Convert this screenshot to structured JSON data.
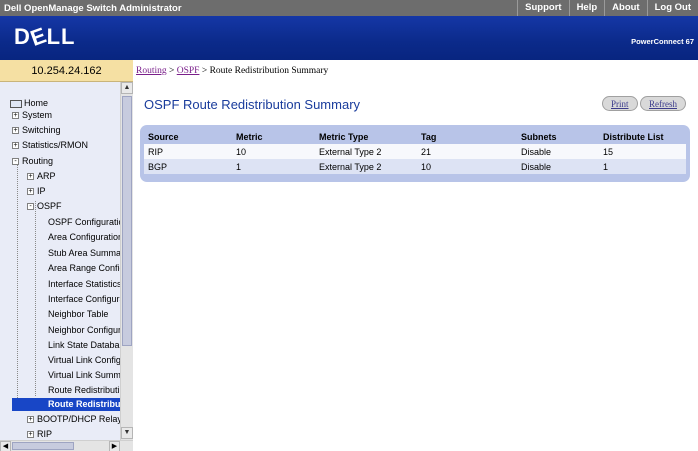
{
  "titlebar": {
    "app_title": "Dell OpenManage Switch Administrator",
    "links": [
      "Support",
      "Help",
      "About",
      "Log Out"
    ]
  },
  "banner": {
    "logo": "DELL",
    "product": "PowerConnect 67"
  },
  "ip_address": "10.254.24.162",
  "breadcrumb": {
    "routing": "Routing",
    "ospf": "OSPF",
    "current": "Route Redistribution Summary",
    "sep": ">"
  },
  "nav": {
    "items": [
      {
        "label": "Home",
        "icon": "home-icon"
      },
      {
        "label": "System",
        "expander": "+"
      },
      {
        "label": "Switching",
        "expander": "+"
      },
      {
        "label": "Statistics/RMON",
        "expander": "+"
      },
      {
        "label": "Routing",
        "expander": "-"
      },
      {
        "label": "ARP",
        "expander": "+"
      },
      {
        "label": "IP",
        "expander": "+"
      },
      {
        "label": "OSPF",
        "expander": "-"
      },
      {
        "label": "OSPF Configuratic"
      },
      {
        "label": "Area Configuration"
      },
      {
        "label": "Stub Area Summa"
      },
      {
        "label": "Area Range Config"
      },
      {
        "label": "Interface Statistics"
      },
      {
        "label": "Interface Configura"
      },
      {
        "label": "Neighbor Table"
      },
      {
        "label": "Neighbor Configura"
      },
      {
        "label": "Link State Databa"
      },
      {
        "label": "Virtual Link Config"
      },
      {
        "label": "Virtual Link Summ"
      },
      {
        "label": "Route Redistributi"
      },
      {
        "label": "Route Redistribu",
        "selected": true
      },
      {
        "label": "BOOTP/DHCP Relay",
        "expander": "+"
      },
      {
        "label": "RIP",
        "expander": "+"
      }
    ]
  },
  "main": {
    "title": "OSPF Route Redistribution Summary",
    "print_label": "Print",
    "refresh_label": "Refresh",
    "table": {
      "headers": [
        "Source",
        "Metric",
        "Metric Type",
        "Tag",
        "Subnets",
        "Distribute List"
      ],
      "rows": [
        [
          "RIP",
          "10",
          "External Type 2",
          "21",
          "Disable",
          "15"
        ],
        [
          "BGP",
          "1",
          "External Type 2",
          "10",
          "Disable",
          "1"
        ]
      ]
    }
  },
  "colors": {
    "banner": "#0b2a8a",
    "nav_bg": "#e9ecf7",
    "ip_header": "#f5e0a3",
    "title_blue": "#1a3c9c",
    "table_frame": "#b8c4e8",
    "selected": "#1846c6"
  }
}
